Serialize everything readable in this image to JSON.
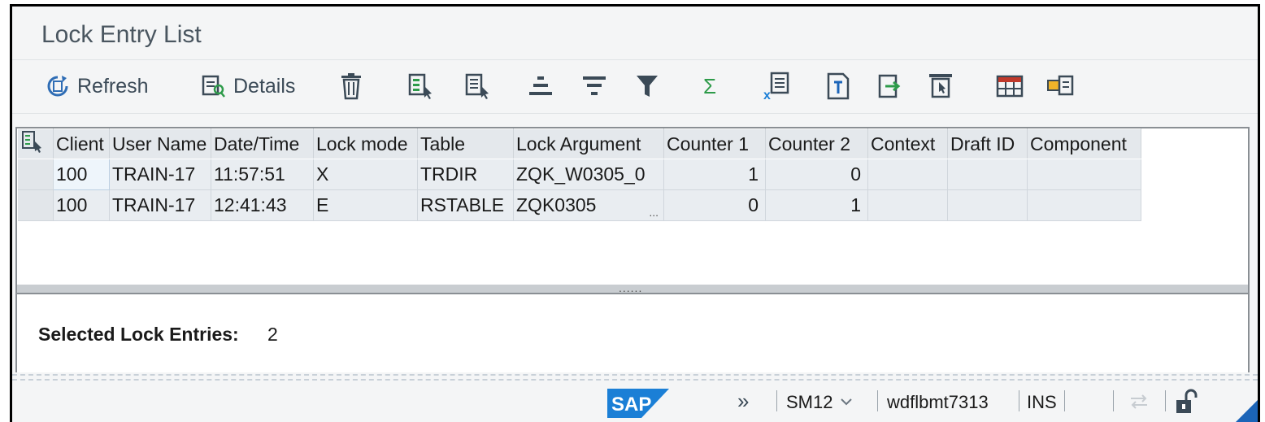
{
  "window": {
    "title": "Lock Entry List"
  },
  "toolbar": {
    "refresh_label": "Refresh",
    "details_label": "Details",
    "icons": [
      "refresh-icon",
      "details-icon",
      "delete-icon",
      "select-layout-icon",
      "choose-layout-icon",
      "sort-ascending-icon",
      "sort-descending-icon",
      "filter-icon",
      "sum-icon",
      "export-spreadsheet-icon",
      "print-preview-icon",
      "export-icon",
      "abc-analysis-icon",
      "change-layout-icon",
      "view-icon"
    ],
    "sum_symbol": "Σ"
  },
  "grid": {
    "columns": [
      "Client",
      "User Name",
      "Date/Time",
      "Lock mode",
      "Table",
      "Lock Argument",
      "Counter 1",
      "Counter 2",
      "Context",
      "Draft ID",
      "Component"
    ],
    "rows": [
      [
        "100",
        "TRAIN-17",
        "11:57:51",
        "X",
        "TRDIR",
        "ZQK_W0305_0",
        "1",
        "0",
        "",
        "",
        ""
      ],
      [
        "100",
        "TRAIN-17",
        "12:41:43",
        "E",
        "RSTABLE",
        "ZQK0305",
        "0",
        "1",
        "",
        "",
        ""
      ]
    ],
    "overflow_marker": "...",
    "sash_marker": "......"
  },
  "info": {
    "label": "Selected Lock Entries:",
    "value": "2"
  },
  "status": {
    "logo": "SAP",
    "expand_glyph": "»",
    "transaction": "SM12",
    "server": "wdflbmt7313",
    "mode": "INS"
  },
  "colors": {
    "accent": "#1b64b8",
    "toolbar_icon": "#3b4a57",
    "sum_green": "#2e9b4a",
    "logo_blue": "#1b7fd6"
  }
}
